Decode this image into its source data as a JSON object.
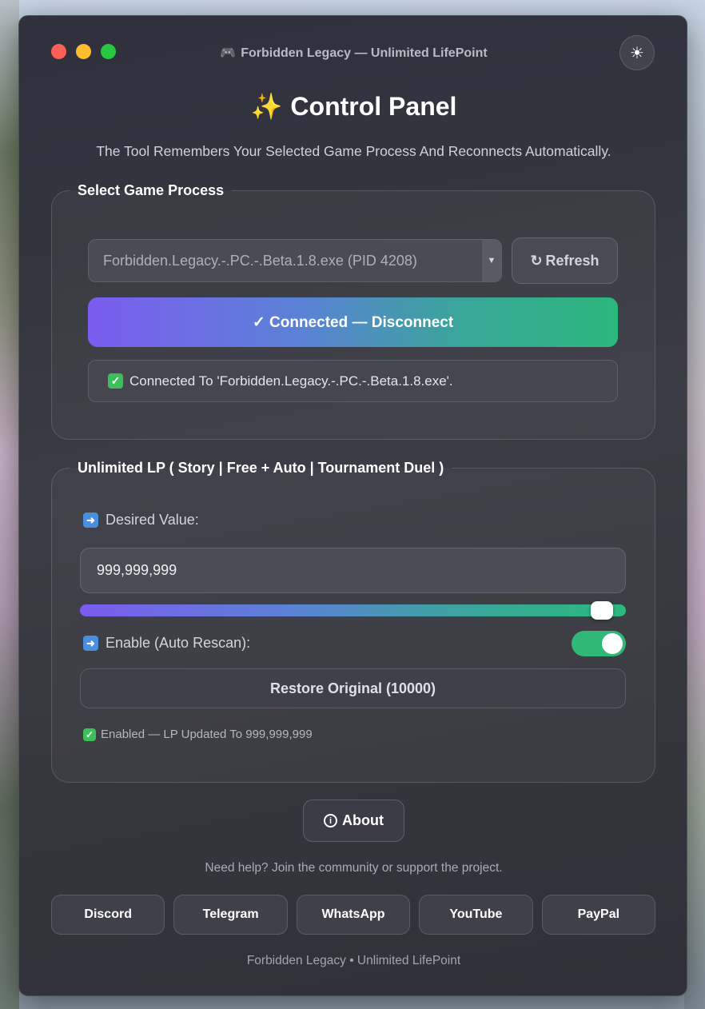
{
  "window": {
    "title": "Forbidden Legacy — Unlimited LifePoint",
    "title_icon": "gamepad-icon",
    "theme_icon": "sun-icon"
  },
  "header": {
    "title": "Control Panel",
    "title_icon": "✨",
    "subtitle": "The Tool Remembers Your Selected Game Process And Reconnects Automatically."
  },
  "process_group": {
    "legend": "Select Game Process",
    "selected_process": "Forbidden.Legacy.-.PC.-.Beta.1.8.exe  (PID 4208)",
    "refresh_label": "Refresh",
    "refresh_icon": "↻",
    "connect_label": "✓ Connected — Disconnect",
    "status_text": "Connected To 'Forbidden.Legacy.-.PC.-.Beta.1.8.exe'."
  },
  "lp_group": {
    "legend": "Unlimited LP ( Story | Free + Auto | Tournament Duel )",
    "desired_label": "Desired Value:",
    "desired_value": "999,999,999",
    "slider_level": 0.98,
    "enable_label": "Enable (Auto Rescan):",
    "enabled": true,
    "restore_label": "Restore Original (10000)",
    "status_text": "Enabled — LP Updated To 999,999,999"
  },
  "about_label": "About",
  "help_text": "Need help? Join the community or support the project.",
  "social": [
    {
      "label": "Discord"
    },
    {
      "label": "Telegram"
    },
    {
      "label": "WhatsApp"
    },
    {
      "label": "YouTube"
    },
    {
      "label": "PayPal"
    }
  ],
  "footer": "Forbidden Legacy • Unlimited LifePoint",
  "colors": {
    "accent_purple": "#7b5cf0",
    "accent_green": "#2bb87c",
    "close": "#ff5f57",
    "minimize": "#febc2e",
    "maximize": "#28c840"
  }
}
